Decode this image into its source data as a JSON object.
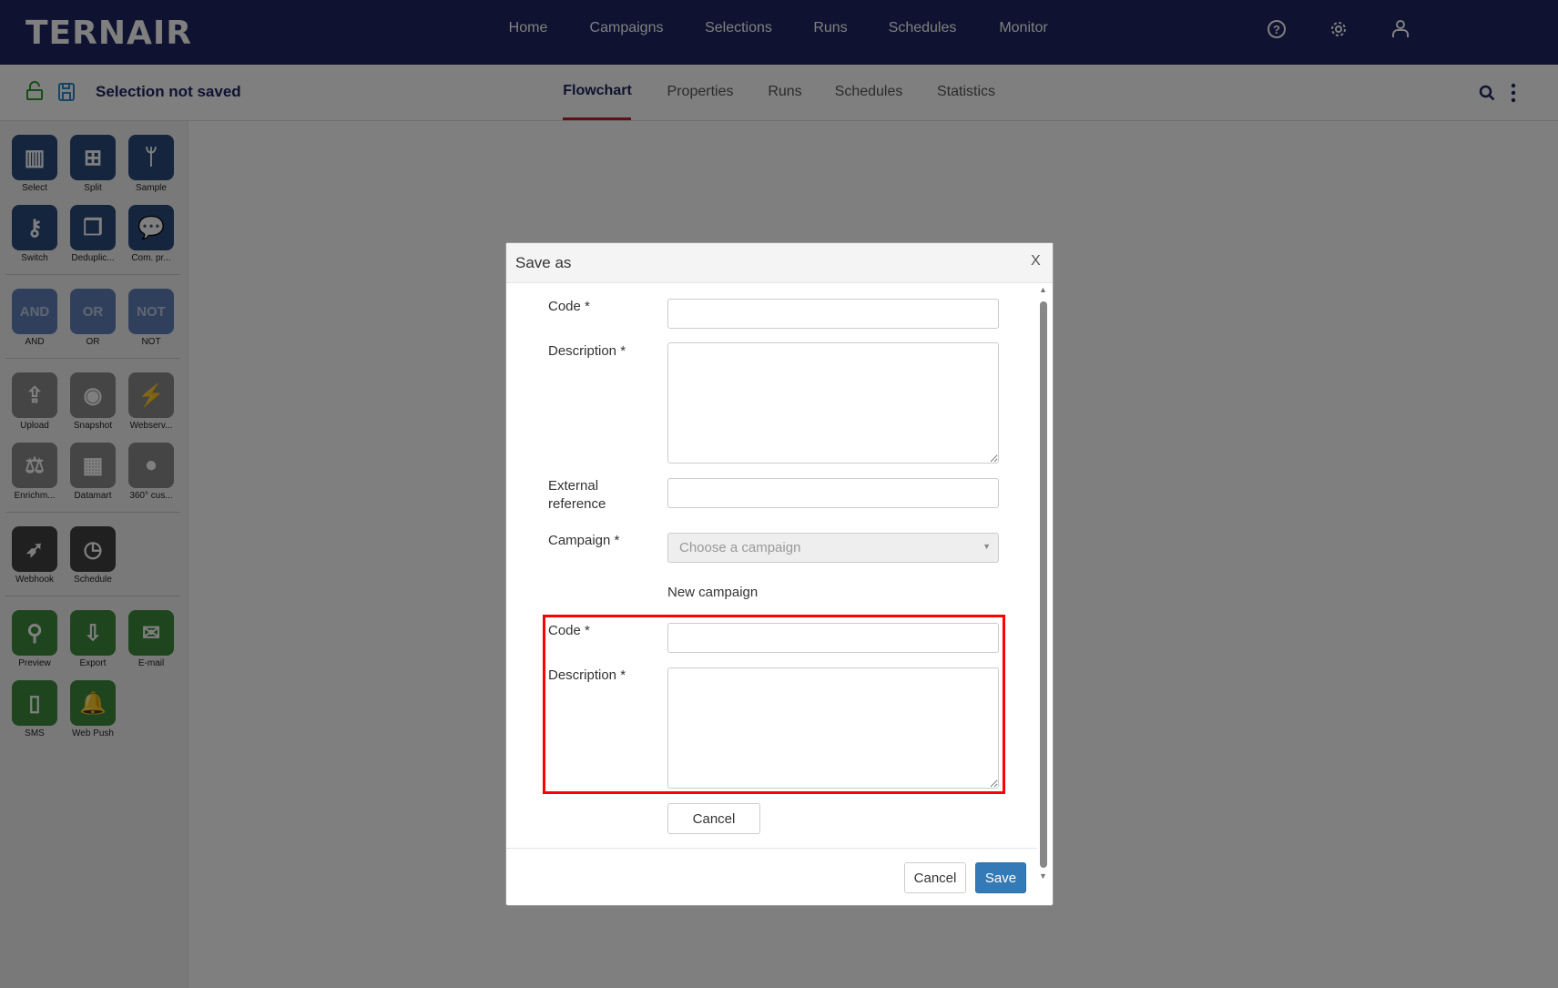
{
  "app": {
    "logo": "TERNAIR",
    "nav": [
      "Home",
      "Campaigns",
      "Selections",
      "Runs",
      "Schedules",
      "Monitor"
    ],
    "icons": [
      "help-icon",
      "gear-icon",
      "user-icon"
    ]
  },
  "subbar": {
    "title": "Selection not saved",
    "tabs": [
      "Flowchart",
      "Properties",
      "Runs",
      "Schedules",
      "Statistics"
    ],
    "active_tab": "Flowchart"
  },
  "sidebar": {
    "groups": [
      {
        "color": "#2c4a7c",
        "items": [
          {
            "label": "Select",
            "icon": "bar-chart-icon"
          },
          {
            "label": "Split",
            "icon": "hierarchy-icon"
          },
          {
            "label": "Sample",
            "icon": "branch-icon"
          },
          {
            "label": "Switch",
            "icon": "key-icon"
          },
          {
            "label": "Deduplic...",
            "icon": "copy-icon"
          },
          {
            "label": "Com. pr...",
            "icon": "comments-icon"
          }
        ]
      },
      {
        "color": "#6080b8",
        "items": [
          {
            "label": "AND",
            "text": "AND"
          },
          {
            "label": "OR",
            "text": "OR"
          },
          {
            "label": "NOT",
            "text": "NOT"
          }
        ]
      },
      {
        "color": "#8a8a8a",
        "items": [
          {
            "label": "Upload",
            "icon": "upload-icon"
          },
          {
            "label": "Snapshot",
            "icon": "camera-icon"
          },
          {
            "label": "Webserv...",
            "icon": "plug-icon"
          },
          {
            "label": "Enrichm...",
            "icon": "scale-icon"
          },
          {
            "label": "Datamart",
            "icon": "table-icon"
          },
          {
            "label": "360° cus...",
            "icon": "person-icon"
          }
        ]
      },
      {
        "color": "#404040",
        "items": [
          {
            "label": "Webhook",
            "icon": "rocket-icon"
          },
          {
            "label": "Schedule",
            "icon": "clock-icon"
          }
        ]
      },
      {
        "color": "#3e8a3e",
        "items": [
          {
            "label": "Preview",
            "icon": "search-icon"
          },
          {
            "label": "Export",
            "icon": "download-icon"
          },
          {
            "label": "E-mail",
            "icon": "envelope-icon"
          },
          {
            "label": "SMS",
            "icon": "mobile-icon"
          },
          {
            "label": "Web Push",
            "icon": "bell-icon"
          }
        ]
      }
    ]
  },
  "dialog": {
    "title": "Save as",
    "close": "X",
    "code_label": "Code *",
    "description_label": "Description *",
    "external_label_1": "External",
    "external_label_2": "reference",
    "campaign_label": "Campaign *",
    "campaign_placeholder": "Choose a campaign",
    "new_campaign": "New campaign",
    "new_code_label": "Code *",
    "new_description_label": "Description *",
    "inner_cancel": "Cancel",
    "cancel": "Cancel",
    "save": "Save"
  },
  "colors": {
    "header": "#1e2560",
    "accent": "#c0202a",
    "primary": "#337ab7",
    "highlight": "#ff0000"
  }
}
